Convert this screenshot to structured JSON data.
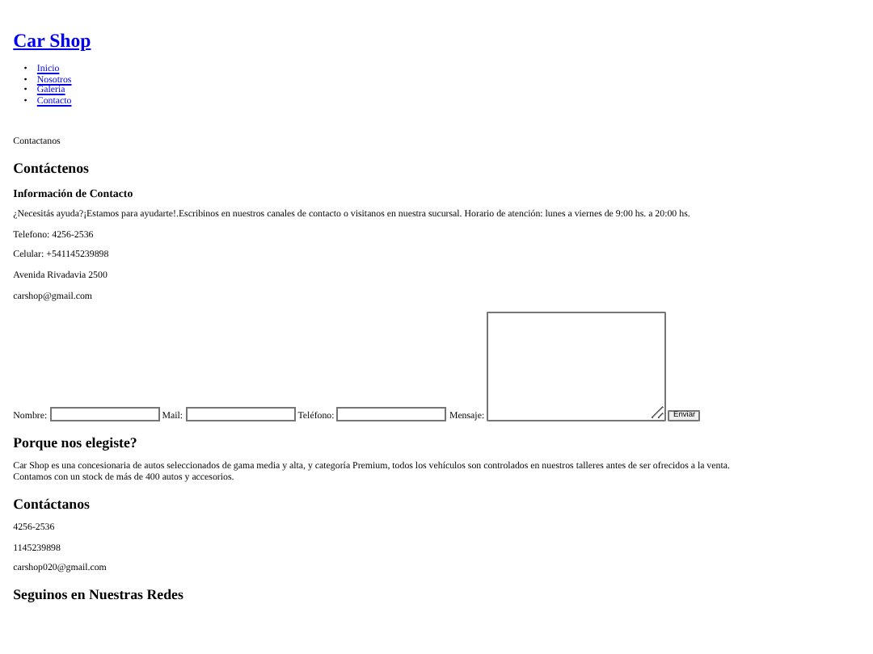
{
  "site_title": "Car Shop",
  "nav": [
    {
      "marker": "•",
      "label": "Inicio"
    },
    {
      "marker": "•",
      "label": "Nosotros"
    },
    {
      "marker": "•",
      "label": "Galeria"
    },
    {
      "marker": "•",
      "label": "Contacto"
    }
  ],
  "page_label": "Contactanos",
  "contact_heading": "Contáctenos",
  "info_heading": "Información de Contacto",
  "info_lines": [
    "¿Necesitás ayuda?¡Estamos para ayudarte!.Escribinos en nuestros canales de contacto o visitanos en nuestra sucursal. Horario de atención: lunes a viernes de 9:00 hs. a 20:00 hs.",
    "Telefono: 4256-2536",
    "Celular: +541145239898",
    "Avenida Rivadavia 2500",
    "carshop@gmail.com"
  ],
  "form": {
    "fields": [
      {
        "label": "Nombre:",
        "kind": "input"
      },
      {
        "label": "Mail:",
        "kind": "input"
      },
      {
        "label": "Teléfono:",
        "kind": "input"
      },
      {
        "label": "Mensaje:",
        "kind": "textarea"
      }
    ],
    "submit": "Enviar"
  },
  "about": {
    "heading": "Porque nos elegiste?",
    "lines": [
      "Car Shop es una concesionaria de autos seleccionados de gama media y alta, y categoría Premium, todos los vehículos son controlados en nuestros talleres antes de ser ofrecidos a la venta.",
      "Contamos con un stock de más de 400 autos y accesorios."
    ]
  },
  "footer_contact": {
    "heading": "Contáctanos",
    "lines": [
      "4256-2536",
      "1145239898",
      "carshop020@gmail.com"
    ]
  },
  "social_heading": "Seguinos en Nuestras Redes"
}
